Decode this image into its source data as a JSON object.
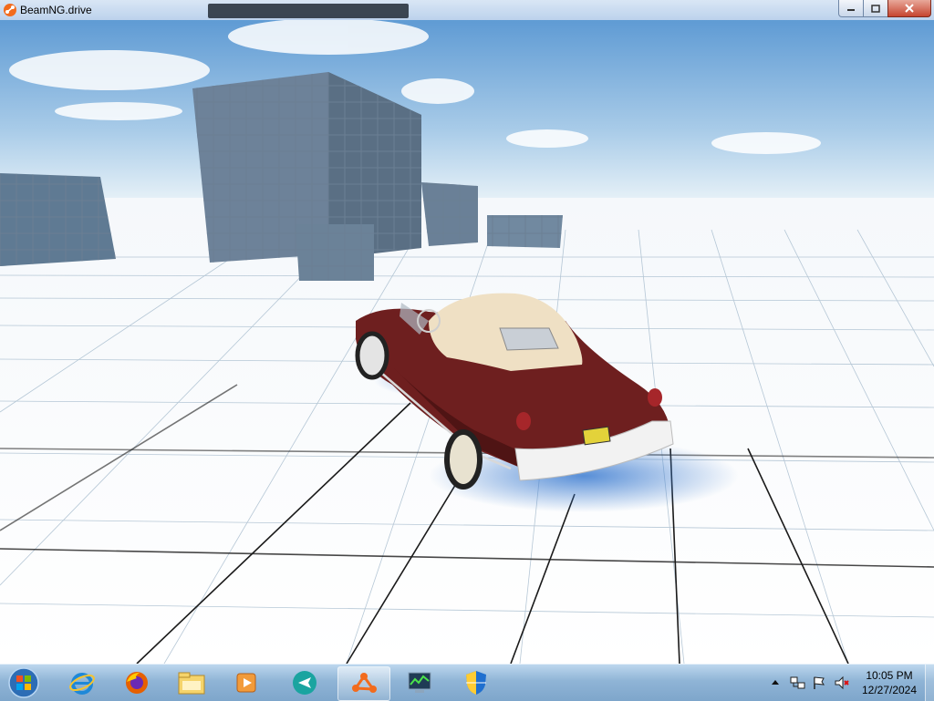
{
  "window": {
    "title": "BeamNG.drive",
    "icon": "beamng-logo-icon",
    "controls": [
      "minimize-icon",
      "maximize-icon",
      "close-icon"
    ]
  },
  "scene": {
    "description_visible": false,
    "sky_color": "#7fb0de",
    "ground_color": "#ffffff",
    "car_body_color": "#6e1f1f",
    "car_top_color": "#efe0c4",
    "shadow_color": "#5b8fd1"
  },
  "taskbar": {
    "items": [
      {
        "name": "internet-explorer-icon"
      },
      {
        "name": "firefox-icon"
      },
      {
        "name": "file-explorer-icon"
      },
      {
        "name": "media-player-icon"
      },
      {
        "name": "teamviewer-icon"
      },
      {
        "name": "beamng-icon",
        "active": true
      },
      {
        "name": "task-manager-icon"
      },
      {
        "name": "security-shield-icon"
      }
    ]
  },
  "tray": {
    "icons": [
      "show-hidden-icon",
      "network-icon",
      "action-center-flag-icon",
      "volume-muted-icon"
    ],
    "time": "10:05 PM",
    "date": "12/27/2024"
  },
  "colors": {
    "taskbar": "#8fb4d6",
    "titlebar": "#c9dbef",
    "beamng_orange": "#f26b1d"
  }
}
